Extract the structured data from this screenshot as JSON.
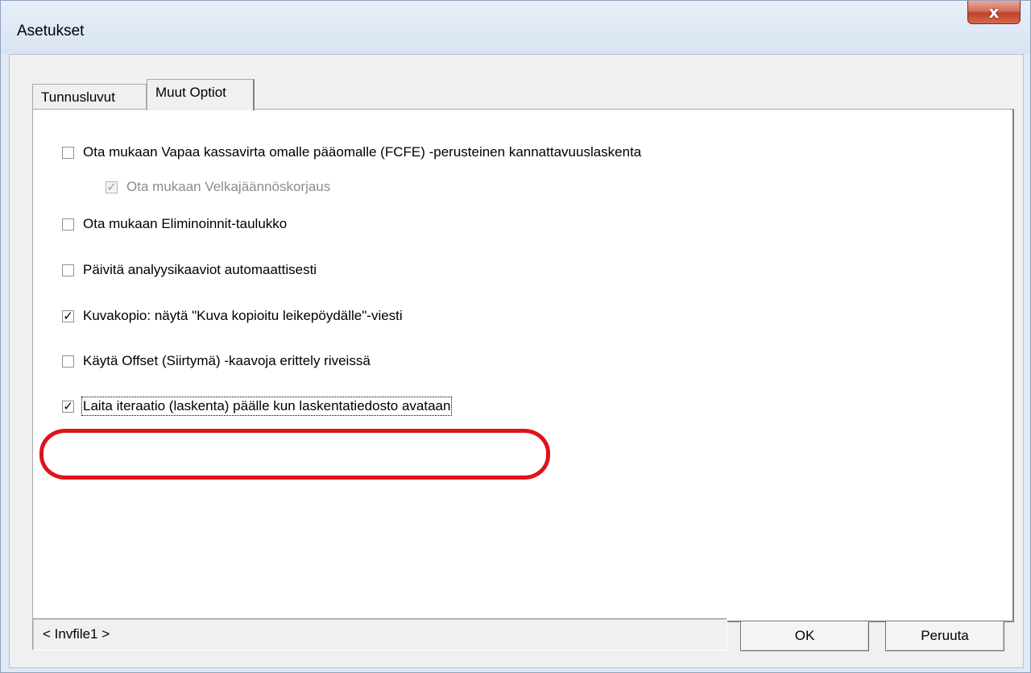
{
  "window": {
    "title": "Asetukset",
    "close_glyph": "x"
  },
  "tabs": [
    {
      "label": "Tunnusluvut",
      "active": false
    },
    {
      "label": "Muut Optiot",
      "active": true
    }
  ],
  "options": [
    {
      "label": "Ota mukaan Vapaa kassavirta omalle pääomalle (FCFE) -perusteinen kannattavuuslaskenta",
      "checked": false,
      "enabled": true
    },
    {
      "label": "Ota mukaan Velkajäännöskorjaus",
      "checked": true,
      "enabled": false
    },
    {
      "label": "Ota mukaan Eliminoinnit-taulukko",
      "checked": false,
      "enabled": true
    },
    {
      "label": "Päivitä analyysikaaviot automaattisesti",
      "checked": false,
      "enabled": true
    },
    {
      "label": "Kuvakopio: näytä \"Kuva kopioitu leikepöydälle\"-viesti",
      "checked": true,
      "enabled": true
    },
    {
      "label": "Käytä Offset (Siirtymä) -kaavoja erittely riveissä",
      "checked": false,
      "enabled": true
    },
    {
      "label": "Laita iteraatio (laskenta) päälle kun laskentatiedosto avataan",
      "checked": true,
      "enabled": true
    }
  ],
  "status": {
    "text": "< Invfile1 >"
  },
  "buttons": {
    "ok_label": "OK",
    "cancel_label": "Peruuta"
  },
  "colors": {
    "highlight_ring": "#e0121a",
    "close_button": "#c2412b"
  }
}
